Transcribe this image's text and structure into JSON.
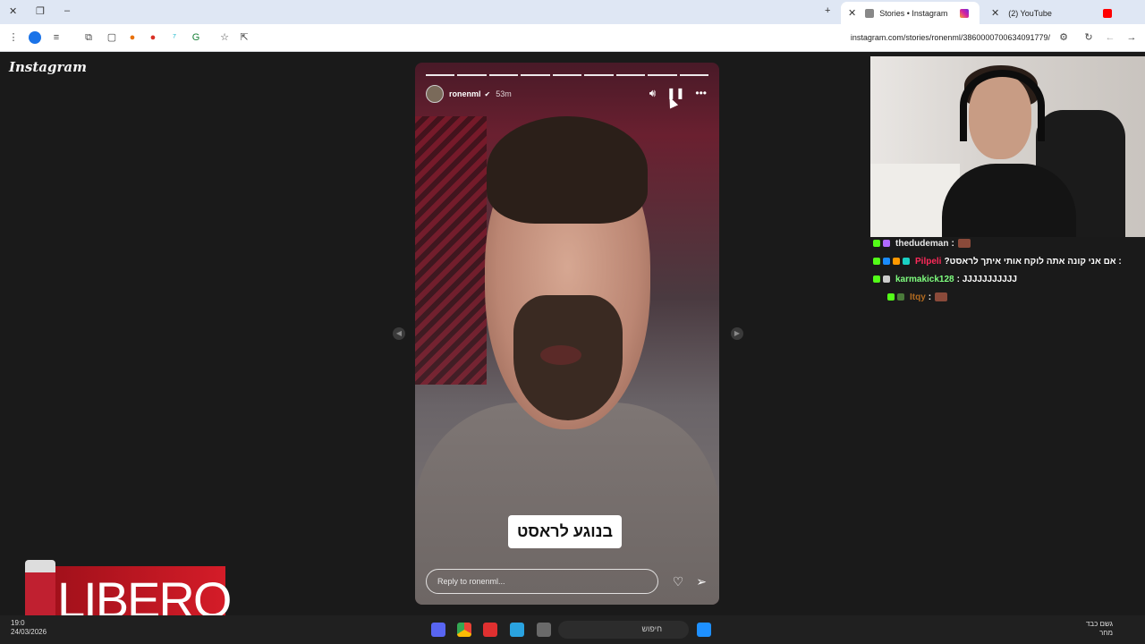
{
  "browser": {
    "tabs": [
      {
        "label": "Stories • Instagram",
        "active": true
      },
      {
        "label": "(2) YouTube",
        "active": false
      }
    ],
    "url": "instagram.com/stories/ronenml/3860000700634091779/"
  },
  "page": {
    "logo": "Instagram",
    "story": {
      "username": "ronenml",
      "time_ago": "53m",
      "caption": "בנוגע לראסט",
      "reply_placeholder": "Reply to ronenml..."
    }
  },
  "chat": {
    "messages": [
      {
        "user": "thedudeman",
        "text": ":",
        "color": "#e8e8e8"
      },
      {
        "user": "Pilpeli",
        "text": ": אם אני קונה אתה לוקח אותי איתך לראסט?",
        "color": "#ff2a5a"
      },
      {
        "user": "karmakick128",
        "text": ": JJJJJJJJJJJ",
        "color": "#7fff7f"
      },
      {
        "user": "Itqy",
        "text": ":",
        "color": "#b06a20"
      }
    ]
  },
  "ad": {
    "brand": "LIBERO"
  },
  "taskbar": {
    "search_label": "חיפוש",
    "time": "19:0",
    "date": "24/03/2026",
    "weather_line1": "גשם כבד",
    "weather_line2": "מחר"
  },
  "colors": {
    "instagram_bg": "#1a1a1a",
    "tab_bg": "#dfe7f4"
  }
}
